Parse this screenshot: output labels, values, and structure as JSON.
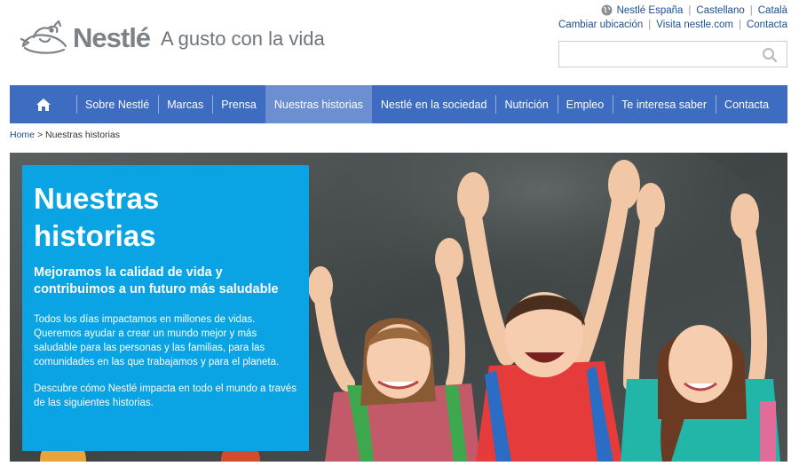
{
  "header": {
    "logo_word": "Nestlé",
    "tagline": "A gusto con la vida",
    "util_links_top": [
      "Nestlé España",
      "Castellano",
      "Català"
    ],
    "util_links_second": [
      "Cambiar ubicación",
      "Visita nestle.com",
      "Contacta"
    ],
    "search_placeholder": "",
    "search_value": ""
  },
  "nav": {
    "home_icon": "home-icon",
    "items": [
      {
        "label": "Sobre Nestlé",
        "active": false
      },
      {
        "label": "Marcas",
        "active": false
      },
      {
        "label": "Prensa",
        "active": false
      },
      {
        "label": "Nuestras historias",
        "active": true
      },
      {
        "label": "Nestlé en la sociedad",
        "active": false
      },
      {
        "label": "Nutrición",
        "active": false
      },
      {
        "label": "Empleo",
        "active": false
      },
      {
        "label": "Te interesa saber",
        "active": false
      },
      {
        "label": "Contacta",
        "active": false
      }
    ]
  },
  "breadcrumb": {
    "home": "Home",
    "separator": ">",
    "current": "Nuestras historias"
  },
  "hero": {
    "title_line1": "Nuestras",
    "title_line2": "historias",
    "subtitle": "Mejoramos la calidad de vida y contribuimos a un futuro más saludable",
    "paragraph1": "Todos los días impactamos en millones de vidas. Queremos ayudar a crear un mundo mejor y más saludable para las personas y las familias, para las comunidades en las que trabajamos y para el planeta.",
    "paragraph2": "Descubre cómo Nestlé impacta en todo el mundo a través de las siguientes historias."
  },
  "colors": {
    "nav_bg": "#3d6cc0",
    "nav_active": "#6b8fd1",
    "hero_panel": "#0aa3e3",
    "link": "#1b4f8e"
  }
}
